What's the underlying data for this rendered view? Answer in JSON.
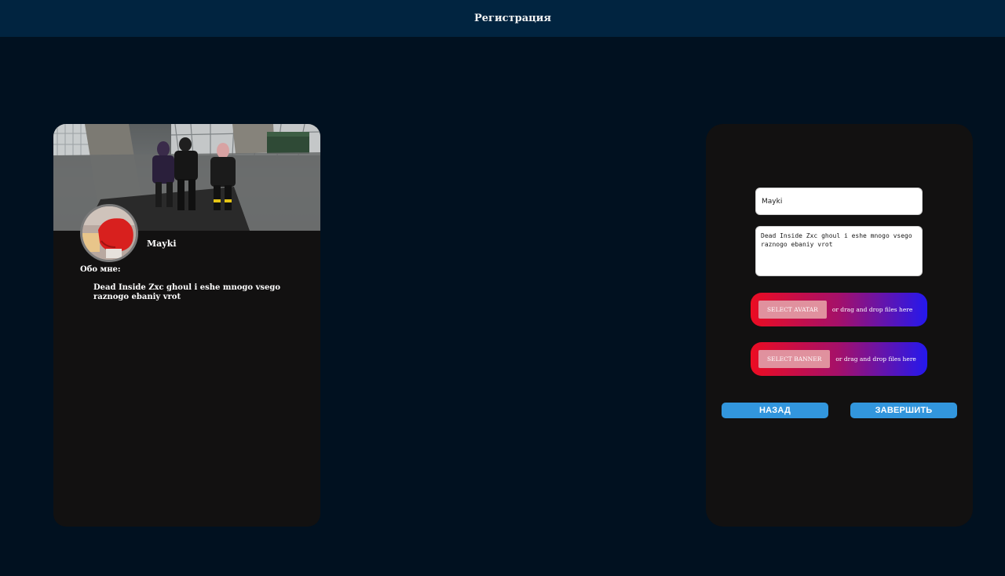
{
  "header": {
    "title": "Регистрация"
  },
  "profile_preview": {
    "username": "Mayki",
    "about_label": "Обо мне:",
    "about_text": "Dead Inside Zxc ghoul i eshe mnogo vsego raznogo ebaniy vrot",
    "banner_image": "group-photo-rooftop",
    "avatar_image": "red-boxing-glove"
  },
  "form": {
    "name_value": "Mayki",
    "about_value": "Dead Inside Zxc ghoul i eshe mnogo vsego raznogo ebaniy vrot",
    "avatar_upload": {
      "button_label": "SELECT AVATAR",
      "hint": "or drag and drop files here"
    },
    "banner_upload": {
      "button_label": "SELECT BANNER",
      "hint": "or drag and drop files here"
    },
    "back_label": "НАЗАД",
    "finish_label": "ЗАВЕРШИТЬ"
  },
  "colors": {
    "page_background": "#011120",
    "header_background": "#012440",
    "card_background": "#121111",
    "button_blue": "#3296dd",
    "gradient_start": "#ec0c22",
    "gradient_end": "#2418ee"
  }
}
